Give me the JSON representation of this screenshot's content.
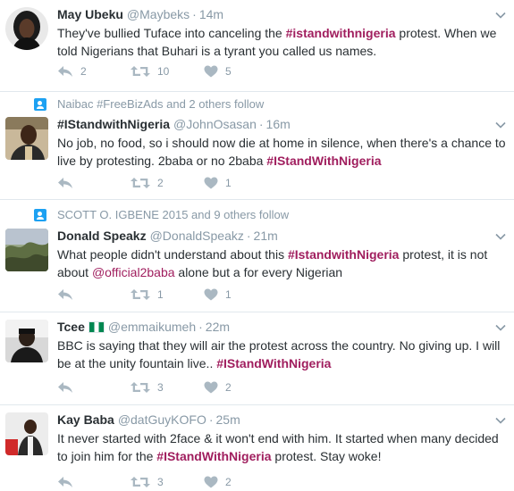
{
  "tweets": [
    {
      "name": "May Ubeku",
      "handle": "@Maybeks",
      "time": "14m",
      "text_parts": [
        "They've bullied Tuface into canceling the ",
        "#istandwithnigeria",
        " protest. When we told Nigerians that Buhari is a tyrant you called us names."
      ],
      "replies": "2",
      "retweets": "10",
      "likes": "5"
    },
    {
      "context": "Naibac #FreeBizAds and 2 others follow",
      "name": "#IStandwithNigeria",
      "handle": "@JohnOsasan",
      "time": "16m",
      "text_parts": [
        "No job, no food, so i should now die at home in silence, when there's a chance to live by protesting. 2baba or no 2baba ",
        "#IStandWithNigeria"
      ],
      "replies": "",
      "retweets": "2",
      "likes": "1"
    },
    {
      "context": "SCOTT O. IGBENE 2015 and 9 others follow",
      "name": "Donald Speakz",
      "handle": "@DonaldSpeakz",
      "time": "21m",
      "text_parts": [
        "What people didn't understand about this ",
        "#IstandwithNigeria",
        " protest, it is not about ",
        "@official2baba",
        " alone but a for every Nigerian"
      ],
      "replies": "",
      "retweets": "1",
      "likes": "1"
    },
    {
      "name": "Tcee",
      "handle": "@emmaikumeh",
      "time": "22m",
      "text_parts": [
        "BBC is saying that they will air the protest across the country. No giving up. I will be at the unity fountain live.. ",
        "#IStandWithNigeria"
      ],
      "replies": "",
      "retweets": "3",
      "likes": "2"
    },
    {
      "name": "Kay Baba",
      "handle": "@datGuyKOFO",
      "time": "25m",
      "text_parts": [
        "It never started with 2face & it won't end with him. It started when many decided to join him for the ",
        "#IStandWithNigeria",
        " protest. Stay woke!"
      ],
      "replies": "",
      "retweets": "3",
      "likes": "2"
    }
  ],
  "icons": {
    "reply": "reply-icon",
    "retweet": "retweet-icon",
    "like": "heart-icon",
    "more": "chevron-down-icon",
    "follow": "follow-person-icon",
    "flag": "nigeria-flag-icon"
  },
  "colors": {
    "hashtag": "#a01e5e",
    "meta": "#8899a6",
    "icon": "#aab8c2",
    "context_icon": "#1da1f2"
  }
}
